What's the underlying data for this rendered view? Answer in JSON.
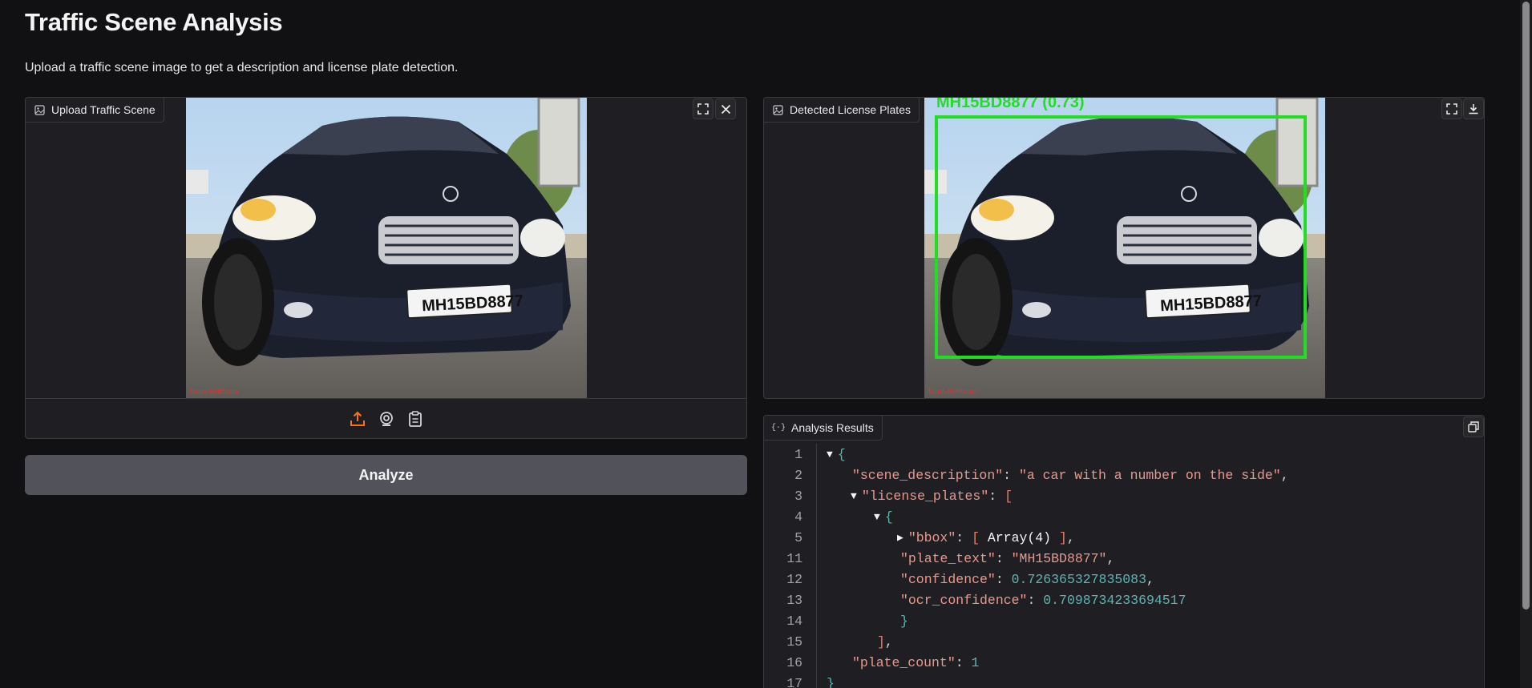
{
  "header": {
    "title": "Traffic Scene Analysis",
    "subtitle": "Upload a traffic scene image to get a description and license plate detection."
  },
  "upload_panel": {
    "label": "Upload Traffic Scene",
    "plate_text": "MH15BD8877",
    "watermark": "Team-BHP.com",
    "tools": [
      "upload-icon",
      "webcam-icon",
      "clipboard-icon"
    ]
  },
  "analyze_button": {
    "label": "Analyze"
  },
  "detected_panel": {
    "label": "Detected License Plates",
    "detection_label": "MH15BD8877 (0.73)",
    "plate_text": "MH15BD8877",
    "watermark": "Team-BHP.com",
    "box_color": "#22dd22"
  },
  "results_panel": {
    "label": "Analysis Results",
    "lines": {
      "n1": "1",
      "n2": "2",
      "n3": "3",
      "n4": "4",
      "n5": "5",
      "n11": "11",
      "n12": "12",
      "n13": "13",
      "n14": "14",
      "n15": "15",
      "n16": "16",
      "n17": "17"
    },
    "json": {
      "scene_description_key": "\"scene_description\"",
      "scene_description_val": "\"a car with a number on the side\"",
      "license_plates_key": "\"license_plates\"",
      "bbox_key": "\"bbox\"",
      "bbox_summary": "Array(4)",
      "plate_text_key": "\"plate_text\"",
      "plate_text_val": "\"MH15BD8877\"",
      "confidence_key": "\"confidence\"",
      "confidence_val": "0.726365327835083",
      "ocr_confidence_key": "\"ocr_confidence\"",
      "ocr_confidence_val": "0.7098734233694517",
      "plate_count_key": "\"plate_count\"",
      "plate_count_val": "1"
    }
  },
  "colors": {
    "background": "#111113",
    "panel": "#1f1f23",
    "accent": "#f97316",
    "button": "#52525b"
  }
}
